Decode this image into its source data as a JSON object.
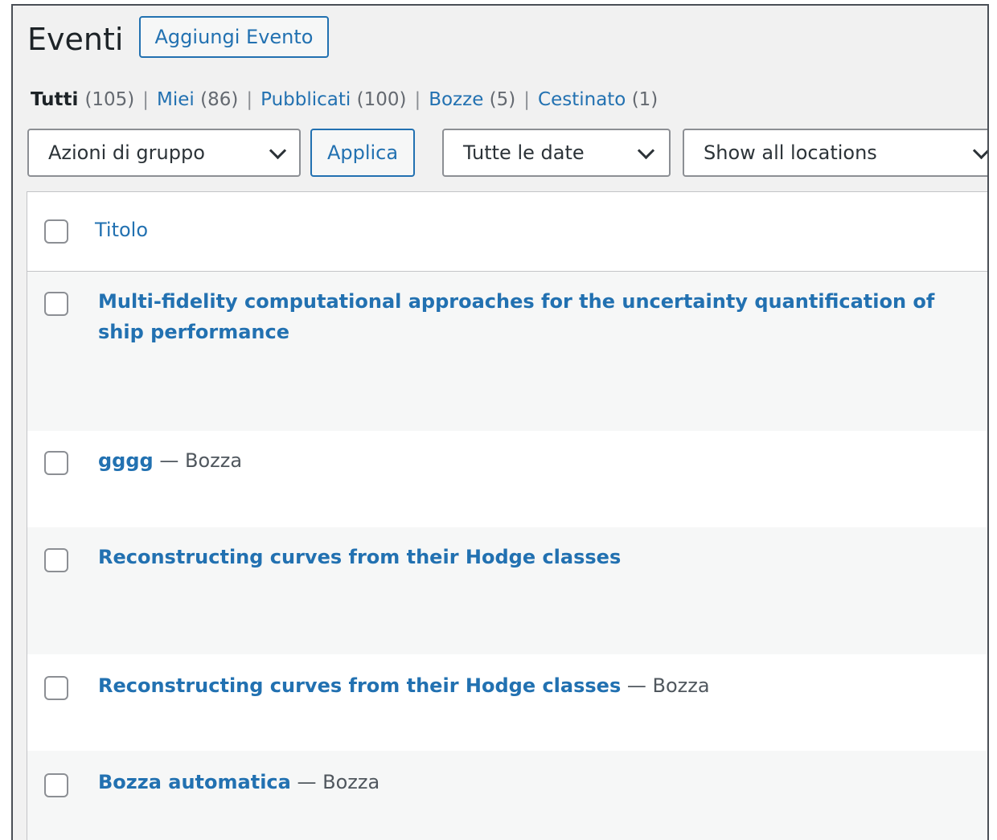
{
  "header": {
    "title": "Eventi",
    "add_button": "Aggiungi Evento"
  },
  "views": [
    {
      "label": "Tutti",
      "count": "(105)",
      "current": true
    },
    {
      "label": "Miei",
      "count": "(86)"
    },
    {
      "label": "Pubblicati",
      "count": "(100)"
    },
    {
      "label": "Bozze",
      "count": "(5)"
    },
    {
      "label": "Cestinato",
      "count": "(1)"
    }
  ],
  "separator": "|",
  "filters": {
    "bulk_actions": "Azioni di gruppo",
    "apply": "Applica",
    "dates": "Tutte le date",
    "locations": "Show all locations"
  },
  "table": {
    "column_title": "Titolo",
    "rows": [
      {
        "title": "Multi-fidelity computational approaches for the uncertainty quantification of ship performance",
        "state": ""
      },
      {
        "title": "gggg",
        "state": " — Bozza"
      },
      {
        "title": "Reconstructing curves from their Hodge classes",
        "state": ""
      },
      {
        "title": "Reconstructing curves from their Hodge classes",
        "state": " — Bozza"
      },
      {
        "title": "Bozza automatica",
        "state": " — Bozza"
      }
    ]
  },
  "colors": {
    "link": "#2271b1",
    "background": "#f1f1f1",
    "row_alt": "#f6f7f7"
  }
}
